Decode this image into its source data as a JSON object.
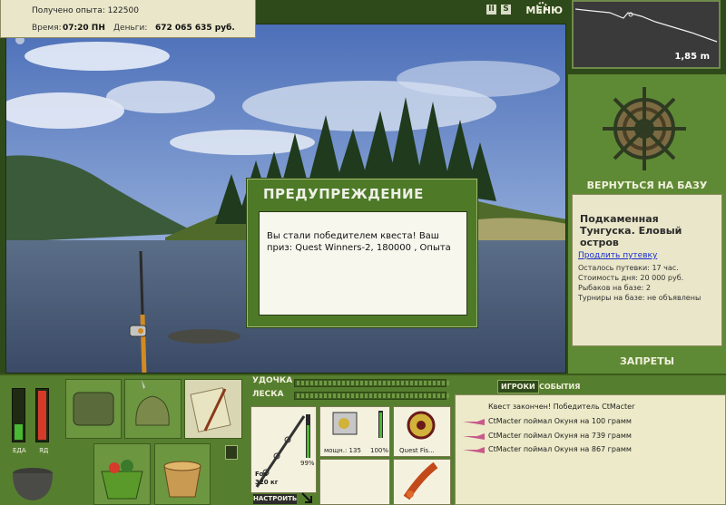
{
  "header": {
    "experience_label": "Получено опыта: 122500",
    "time_label": "Время:",
    "time_value": "07:20 ПН",
    "money_label": "Деньги:",
    "money_value": "672 065 635 руб.",
    "menu_label": "МЕНЮ",
    "pause_icon": "II",
    "sound_icon": "S"
  },
  "depth_panel": {
    "depth_value": "1,85 m"
  },
  "right_panel": {
    "back_to_base": "ВЕРНУТЬСЯ НА БАЗУ",
    "location_title": "Подкаменная Тунгуска. Еловый остров",
    "extend_link": "Продлить путевку",
    "info_lines": [
      "Осталось путевки: 17 час.",
      "Стоимость дня: 20 000 руб.",
      "Рыбаков на базе: 2",
      "Турниры на базе: не объявлены"
    ],
    "bans": "ЗАПРЕТЫ"
  },
  "dialog": {
    "title": "ПРЕДУПРЕЖДЕНИЕ",
    "message": "Вы стали победителем квеста! Ваш приз: Quest Winners-2, 180000 , Опыта"
  },
  "status_bars": {
    "food_label": "ЕДА",
    "poison_label": "ЯД",
    "food_level": 0.3,
    "poison_level": 0.97
  },
  "rod_panel": {
    "rod_label": "УДОЧКА",
    "line_label": "ЛЕСКА",
    "rod_name": "Fox",
    "rod_weight": "320 кг",
    "rod_percent": "99%",
    "reel_power": "мощн.: 135",
    "reel_percent": "100%",
    "line_name": "Quest Fis...",
    "adjust_button": "НАСТРОИТЬ"
  },
  "chat": {
    "tab_players": "ИГРОКИ",
    "tab_events": "СОБЫТИЯ",
    "messages": [
      "Квест закончен! Победитель CtMacter",
      "CtMacter поймал Окуня на 100 грамм",
      "CtMacter поймал Окуня на 739 грамм",
      "CtMacter поймал Окуня на 867 грамм"
    ]
  },
  "colors": {
    "panel_green": "#567e2f",
    "panel_light": "#e9e6c9",
    "dialog_green": "#4e7a28",
    "link_blue": "#1a2ecc"
  }
}
